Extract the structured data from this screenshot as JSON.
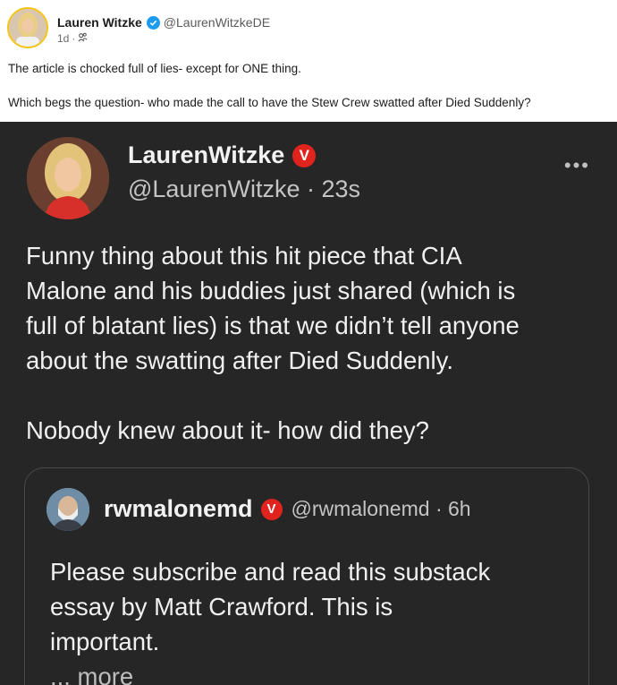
{
  "post": {
    "author_name": "Lauren Witzke",
    "author_handle": "@LaurenWitzkeDE",
    "time": "1d",
    "separator": "·",
    "text_line1": "The article is chocked full of lies- except for ONE thing.",
    "text_line2": "Which begs the question- who made the call to have the Stew Crew swatted after Died Suddenly?"
  },
  "embedded": {
    "name": "LaurenWitzke",
    "handle": "@LaurenWitzke",
    "separator": "·",
    "time": "23s",
    "more": "•••",
    "body_lines": [
      "Funny thing about this hit piece that CIA",
      "Malone and his buddies just shared (which is",
      "full of blatant lies) is that we didn’t tell anyone",
      "about the swatting after Died Suddenly."
    ],
    "body_line_last": "Nobody knew about it- how did they?",
    "badge_letter": "V",
    "quote": {
      "name": "rwmalonemd",
      "badge_letter": "V",
      "handle": "@rwmalonemd",
      "separator": "·",
      "time": "6h",
      "body_lines": [
        "Please subscribe and read this substack",
        "essay by Matt Crawford.  This is",
        "important."
      ],
      "more": "... more"
    }
  },
  "colors": {
    "verified_blue": "#1d9bf0",
    "badge_red": "#e0241d",
    "dark_bg": "#262626"
  }
}
